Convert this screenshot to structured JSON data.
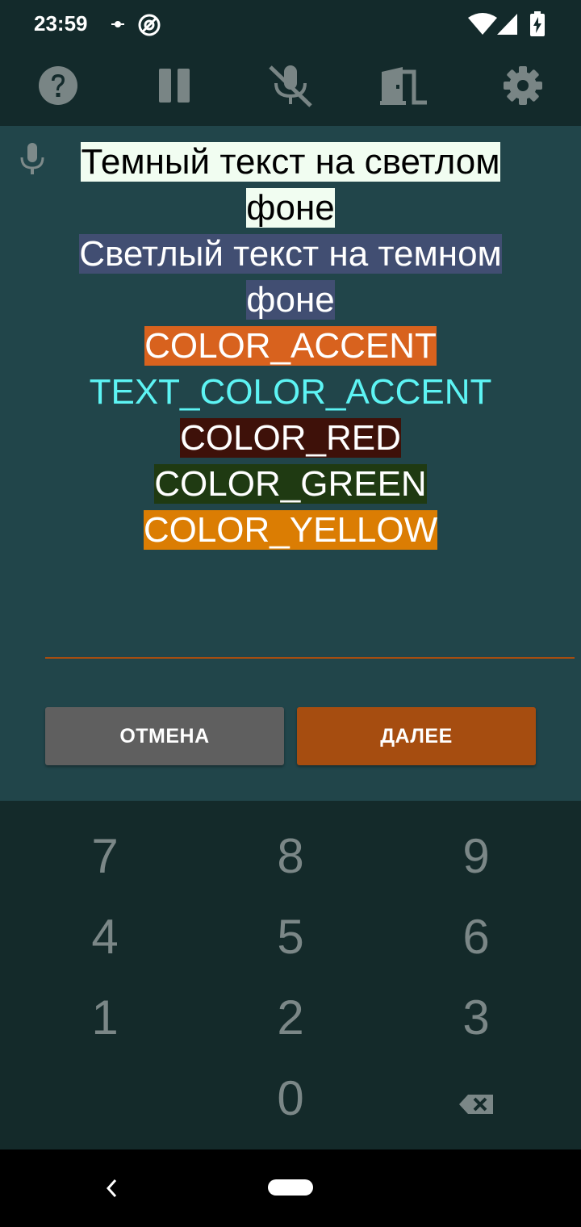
{
  "status_bar": {
    "time": "23:59",
    "icons": [
      "notification-dot-icon",
      "at-sign-icon",
      "wifi-icon",
      "signal-icon",
      "battery-charging-icon"
    ]
  },
  "toolbar": {
    "buttons": [
      "help-icon",
      "pause-icon",
      "mic-off-icon",
      "exit-door-icon",
      "settings-icon"
    ]
  },
  "message": {
    "lines": [
      {
        "text": "Темный текст на светлом фоне",
        "bg": "#f1fdf1",
        "fg": "#000000"
      },
      {
        "text": "Светлый текст на темном фоне",
        "bg": "#414e72",
        "fg": "#ffffff"
      },
      {
        "text": "COLOR_ACCENT",
        "bg": "#d8621e",
        "fg": "#ffffff"
      },
      {
        "text": "TEXT_COLOR_ACCENT",
        "bg": "",
        "fg": "#5df4f4"
      },
      {
        "text": "COLOR_RED",
        "bg": "#3e1109",
        "fg": "#ffffff"
      },
      {
        "text": "COLOR_GREEN",
        "bg": "#1f3a12",
        "fg": "#ffffff"
      },
      {
        "text": "COLOR_YELLOW",
        "bg": "#db7d03",
        "fg": "#ffffff"
      }
    ]
  },
  "actions": {
    "cancel_label": "ОТМЕНА",
    "next_label": "ДАЛЕЕ",
    "cancel_color": "#5f5f5f",
    "next_color": "#a64d10"
  },
  "keypad": {
    "row1": [
      "7",
      "8",
      "9"
    ],
    "row2": [
      "4",
      "5",
      "6"
    ],
    "row3": [
      "1",
      "2",
      "3"
    ],
    "row4": [
      "0"
    ]
  }
}
